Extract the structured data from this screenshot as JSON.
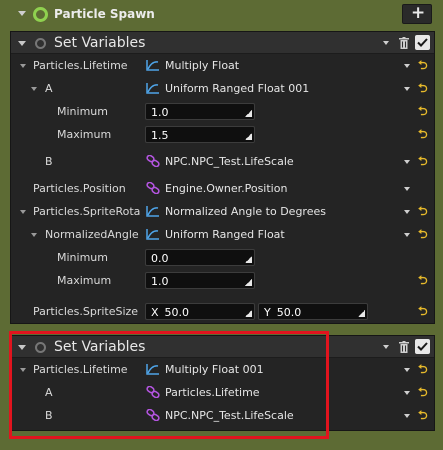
{
  "emitter": {
    "title": "Particle Spawn",
    "add_label": "+"
  },
  "module1": {
    "title": "Set Variables",
    "rows": {
      "lifetime": {
        "label": "Particles.Lifetime",
        "value": "Multiply Float"
      },
      "a": {
        "label": "A",
        "value": "Uniform Ranged Float 001"
      },
      "a_min": {
        "label": "Minimum",
        "value": "1.0"
      },
      "a_max": {
        "label": "Maximum",
        "value": "1.5"
      },
      "b": {
        "label": "B",
        "value": "NPC.NPC_Test.LifeScale"
      },
      "position": {
        "label": "Particles.Position",
        "value": "Engine.Owner.Position"
      },
      "rotation": {
        "label": "Particles.SpriteRota",
        "value": "Normalized Angle to Degrees"
      },
      "norm_angle": {
        "label": "NormalizedAngle",
        "value": "Uniform Ranged Float"
      },
      "n_min": {
        "label": "Minimum",
        "value": "0.0"
      },
      "n_max": {
        "label": "Maximum",
        "value": "1.0"
      },
      "size": {
        "label": "Particles.SpriteSize",
        "x_label": "X",
        "x_value": "50.0",
        "y_label": "Y",
        "y_value": "50.0"
      }
    }
  },
  "module2": {
    "title": "Set Variables",
    "rows": {
      "lifetime": {
        "label": "Particles.Lifetime",
        "value": "Multiply Float 001"
      },
      "a": {
        "label": "A",
        "value": "Particles.Lifetime"
      },
      "b": {
        "label": "B",
        "value": "NPC.NPC_Test.LifeScale"
      }
    }
  },
  "colors": {
    "background": "#5d6b34",
    "panel": "#242424",
    "enabled_icon": "#8fd14f",
    "function_icon": "#4ea4e8",
    "link_icon": "#b455e0",
    "reset_arrow": "#e6b92b",
    "highlight_border": "#e1141e"
  },
  "icons": {
    "collapse": "triangle-down-icon",
    "enabled": "ring-icon",
    "function": "curve-graph-icon",
    "link": "chain-link-icon",
    "reset": "reset-arrow-icon",
    "delete": "trash-icon",
    "checkbox": "check-icon"
  }
}
